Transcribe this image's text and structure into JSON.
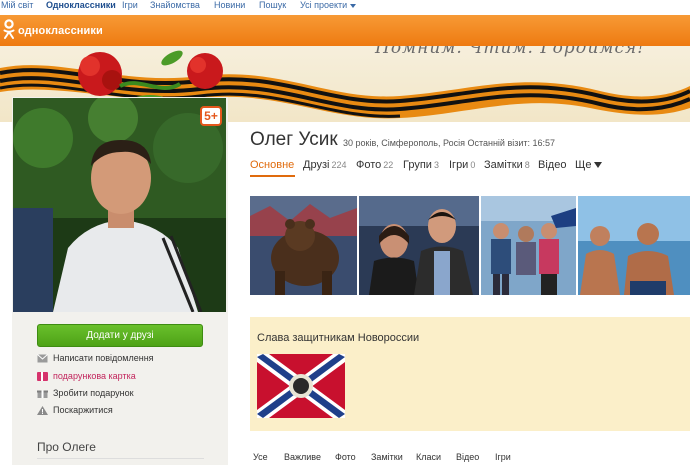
{
  "portal": {
    "items": [
      "Мій світ",
      "Одноклассники",
      "Ігри",
      "Знайомства",
      "Новини",
      "Пошук",
      "Усі проекти"
    ]
  },
  "header": {
    "logo_text": "одноклассники"
  },
  "banner": {
    "text": "Помним. Чтим. Гордимся!"
  },
  "profile": {
    "name": "Олег Усик",
    "meta": "30 років, Сімферополь, Росія Останній візит: 16:57",
    "age_badge": "5+"
  },
  "tabs": [
    {
      "label": "Основне",
      "count": ""
    },
    {
      "label": "Друзі",
      "count": "224"
    },
    {
      "label": "Фото",
      "count": "22"
    },
    {
      "label": "Групи",
      "count": "3"
    },
    {
      "label": "Ігри",
      "count": "0"
    },
    {
      "label": "Замітки",
      "count": "8"
    },
    {
      "label": "Відео",
      "count": ""
    },
    {
      "label": "Ще",
      "count": ""
    }
  ],
  "actions": {
    "add_friend": "Додати у друзі",
    "message": "Написати повідомлення",
    "gift_card": "подарункова картка",
    "gift": "Зробити подарунок",
    "complain": "Поскаржитися"
  },
  "about": "Про Олеге",
  "status": {
    "text": "Слава защитникам Новороссии"
  },
  "feed_tabs": [
    "Усе",
    "Важливе",
    "Фото",
    "Замітки",
    "Класи",
    "Відео",
    "Ігри"
  ],
  "colors": {
    "accent": "#ee7a11",
    "link": "#3b6aa6",
    "button": "#4ea217",
    "status_bg": "#fbefc9"
  },
  "icons": [
    "odnoklassniki-logo-icon",
    "envelope-icon",
    "gift-card-icon",
    "gift-icon",
    "warning-icon",
    "chevron-down-icon"
  ]
}
